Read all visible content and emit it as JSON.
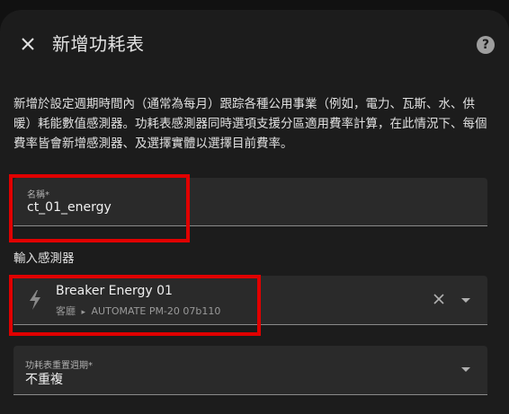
{
  "dialog": {
    "title": "新增功耗表",
    "help_icon": "help-circle-icon",
    "close_icon": "close-icon",
    "description": "新增於設定週期時間內（通常為每月）跟踪各種公用事業（例如，電力、瓦斯、水、供暖）耗能數值感測器。功耗表感測器同時選項支援分區適用費率計算，在此情況下、每個費率皆會新增感測器、及選擇實體以選擇目前費率。"
  },
  "name_field": {
    "label": "名稱*",
    "value": "ct_01_energy"
  },
  "input_sensor": {
    "section_label": "輸入感測器",
    "entity_icon": "lightning-bolt-icon",
    "entity_name": "Breaker Energy 01",
    "area": "客廳",
    "separator": "▸",
    "device": "AUTOMATE PM-20 07b110"
  },
  "cycle_field": {
    "label": "功耗表重置週期*",
    "value": "不重複"
  },
  "colors": {
    "highlight": "#e00000",
    "background": "#1c1c1c",
    "field_background": "#2a2a2a"
  }
}
